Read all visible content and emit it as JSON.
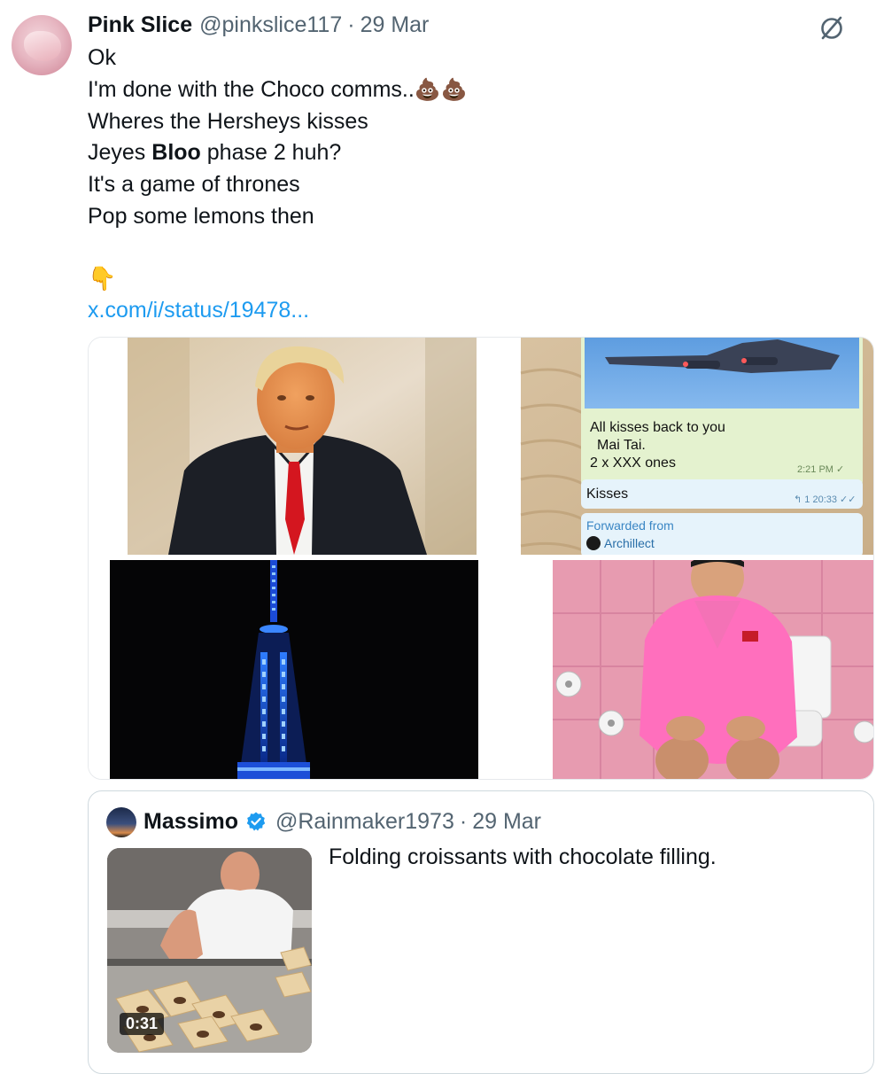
{
  "tweet": {
    "author_name": "Pink Slice",
    "handle": "@pinkslice117",
    "separator": "·",
    "date": "29 Mar",
    "lines": [
      "Ok",
      "I'm done with the Choco comms..",
      "Wheres the Hersheys kisses",
      "Jeyes",
      "Bloo",
      "phase 2 huh?",
      "It's a game of thrones",
      "Pop some lemons then"
    ],
    "emojis": {
      "poop_pair": "💩💩",
      "pointing": "👇"
    },
    "link": "x.com/i/status/19478..."
  },
  "media": {
    "chat_screenshot": {
      "message_lines": [
        "All kisses back to you",
        "Mai  Tai.",
        "2 x XXX ones"
      ],
      "message_time": "2:21 PM",
      "reply_text": "Kisses",
      "reply_meta": "1  20:33",
      "forwarded_label": "Forwarded from",
      "forwarded_source": "Archillect"
    }
  },
  "quote": {
    "author_name": "Massimo",
    "handle": "@Rainmaker1973",
    "separator": "·",
    "date": "29 Mar",
    "text": "Folding croissants with chocolate filling.",
    "video_duration": "0:31"
  },
  "icons": {
    "grok": "grok-icon",
    "verified": "verified-badge-icon"
  },
  "colors": {
    "link": "#1d9bf0",
    "secondary_text": "#536471",
    "verified": "#1d9bf0"
  }
}
